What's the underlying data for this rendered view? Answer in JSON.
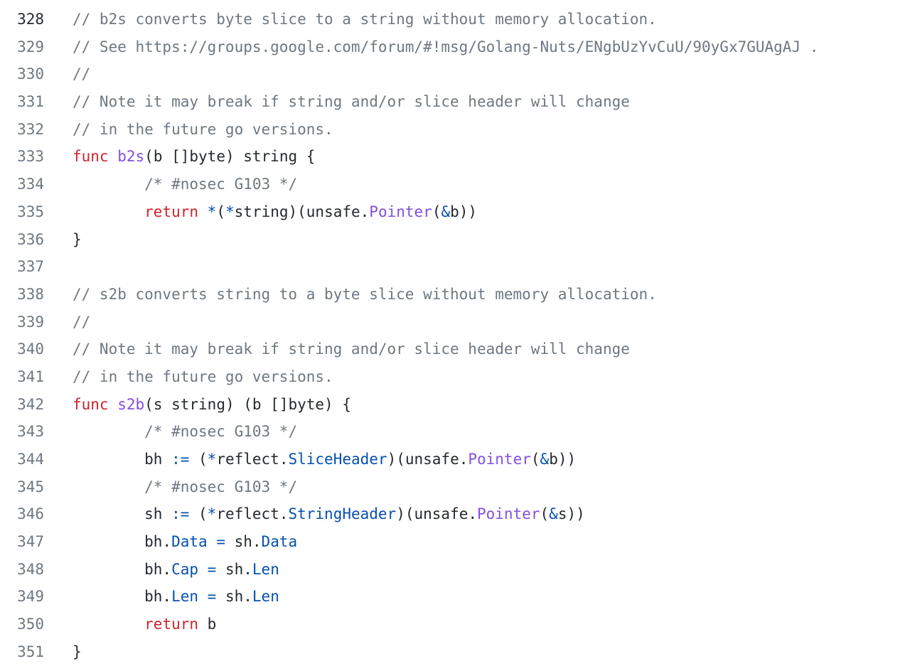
{
  "code_view": {
    "active_line": 328,
    "colors": {
      "comment": "#6e7781",
      "keyword": "#cf222e",
      "function": "#8250df",
      "operator": "#0550ae",
      "text": "#24292f"
    },
    "lines": [
      {
        "number": "328",
        "tokens": [
          {
            "t": "c",
            "v": "// b2s converts byte slice to a string without memory allocation."
          }
        ]
      },
      {
        "number": "329",
        "tokens": [
          {
            "t": "c",
            "v": "// See https://groups.google.com/forum/#!msg/Golang-Nuts/ENgbUzYvCuU/90yGx7GUAgAJ ."
          }
        ]
      },
      {
        "number": "330",
        "tokens": [
          {
            "t": "c",
            "v": "//"
          }
        ]
      },
      {
        "number": "331",
        "tokens": [
          {
            "t": "c",
            "v": "// Note it may break if string and/or slice header will change"
          }
        ]
      },
      {
        "number": "332",
        "tokens": [
          {
            "t": "c",
            "v": "// in the future go versions."
          }
        ]
      },
      {
        "number": "333",
        "tokens": [
          {
            "t": "k",
            "v": "func"
          },
          {
            "t": "d",
            "v": " "
          },
          {
            "t": "f",
            "v": "b2s"
          },
          {
            "t": "d",
            "v": "(b []byte) string {"
          }
        ]
      },
      {
        "number": "334",
        "tokens": [
          {
            "t": "d",
            "v": "        "
          },
          {
            "t": "c",
            "v": "/* #nosec G103 */"
          }
        ]
      },
      {
        "number": "335",
        "tokens": [
          {
            "t": "d",
            "v": "        "
          },
          {
            "t": "k",
            "v": "return"
          },
          {
            "t": "d",
            "v": " "
          },
          {
            "t": "o",
            "v": "*"
          },
          {
            "t": "d",
            "v": "("
          },
          {
            "t": "o",
            "v": "*"
          },
          {
            "t": "d",
            "v": "string)(unsafe."
          },
          {
            "t": "f",
            "v": "Pointer"
          },
          {
            "t": "d",
            "v": "("
          },
          {
            "t": "o",
            "v": "&"
          },
          {
            "t": "d",
            "v": "b))"
          }
        ]
      },
      {
        "number": "336",
        "tokens": [
          {
            "t": "d",
            "v": "}"
          }
        ]
      },
      {
        "number": "337",
        "tokens": []
      },
      {
        "number": "338",
        "tokens": [
          {
            "t": "c",
            "v": "// s2b converts string to a byte slice without memory allocation."
          }
        ]
      },
      {
        "number": "339",
        "tokens": [
          {
            "t": "c",
            "v": "//"
          }
        ]
      },
      {
        "number": "340",
        "tokens": [
          {
            "t": "c",
            "v": "// Note it may break if string and/or slice header will change"
          }
        ]
      },
      {
        "number": "341",
        "tokens": [
          {
            "t": "c",
            "v": "// in the future go versions."
          }
        ]
      },
      {
        "number": "342",
        "tokens": [
          {
            "t": "k",
            "v": "func"
          },
          {
            "t": "d",
            "v": " "
          },
          {
            "t": "f",
            "v": "s2b"
          },
          {
            "t": "d",
            "v": "(s string) (b []byte) {"
          }
        ]
      },
      {
        "number": "343",
        "tokens": [
          {
            "t": "d",
            "v": "        "
          },
          {
            "t": "c",
            "v": "/* #nosec G103 */"
          }
        ]
      },
      {
        "number": "344",
        "tokens": [
          {
            "t": "d",
            "v": "        bh "
          },
          {
            "t": "o",
            "v": ":="
          },
          {
            "t": "d",
            "v": " ("
          },
          {
            "t": "o",
            "v": "*"
          },
          {
            "t": "d",
            "v": "reflect."
          },
          {
            "t": "o",
            "v": "SliceHeader"
          },
          {
            "t": "d",
            "v": ")(unsafe."
          },
          {
            "t": "f",
            "v": "Pointer"
          },
          {
            "t": "d",
            "v": "("
          },
          {
            "t": "o",
            "v": "&"
          },
          {
            "t": "d",
            "v": "b))"
          }
        ]
      },
      {
        "number": "345",
        "tokens": [
          {
            "t": "d",
            "v": "        "
          },
          {
            "t": "c",
            "v": "/* #nosec G103 */"
          }
        ]
      },
      {
        "number": "346",
        "tokens": [
          {
            "t": "d",
            "v": "        sh "
          },
          {
            "t": "o",
            "v": ":="
          },
          {
            "t": "d",
            "v": " ("
          },
          {
            "t": "o",
            "v": "*"
          },
          {
            "t": "d",
            "v": "reflect."
          },
          {
            "t": "o",
            "v": "StringHeader"
          },
          {
            "t": "d",
            "v": ")(unsafe."
          },
          {
            "t": "f",
            "v": "Pointer"
          },
          {
            "t": "d",
            "v": "("
          },
          {
            "t": "o",
            "v": "&"
          },
          {
            "t": "d",
            "v": "s))"
          }
        ]
      },
      {
        "number": "347",
        "tokens": [
          {
            "t": "d",
            "v": "        bh."
          },
          {
            "t": "o",
            "v": "Data"
          },
          {
            "t": "d",
            "v": " "
          },
          {
            "t": "o",
            "v": "="
          },
          {
            "t": "d",
            "v": " sh."
          },
          {
            "t": "o",
            "v": "Data"
          }
        ]
      },
      {
        "number": "348",
        "tokens": [
          {
            "t": "d",
            "v": "        bh."
          },
          {
            "t": "o",
            "v": "Cap"
          },
          {
            "t": "d",
            "v": " "
          },
          {
            "t": "o",
            "v": "="
          },
          {
            "t": "d",
            "v": " sh."
          },
          {
            "t": "o",
            "v": "Len"
          }
        ]
      },
      {
        "number": "349",
        "tokens": [
          {
            "t": "d",
            "v": "        bh."
          },
          {
            "t": "o",
            "v": "Len"
          },
          {
            "t": "d",
            "v": " "
          },
          {
            "t": "o",
            "v": "="
          },
          {
            "t": "d",
            "v": " sh."
          },
          {
            "t": "o",
            "v": "Len"
          }
        ]
      },
      {
        "number": "350",
        "tokens": [
          {
            "t": "d",
            "v": "        "
          },
          {
            "t": "k",
            "v": "return"
          },
          {
            "t": "d",
            "v": " b"
          }
        ]
      },
      {
        "number": "351",
        "tokens": [
          {
            "t": "d",
            "v": "}"
          }
        ]
      }
    ]
  }
}
